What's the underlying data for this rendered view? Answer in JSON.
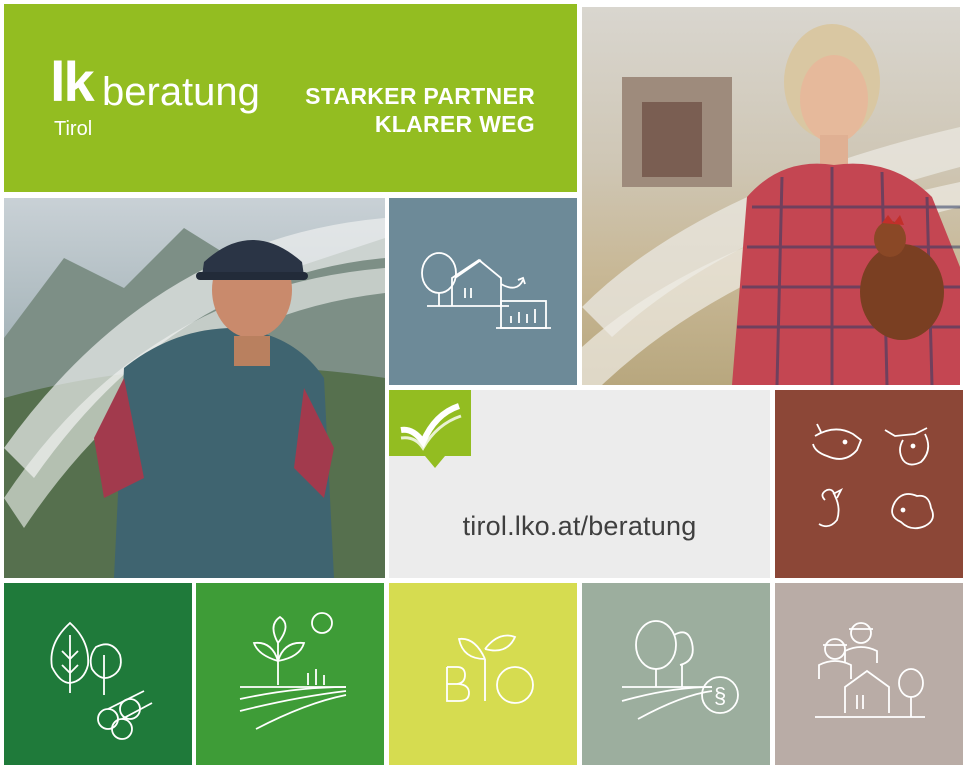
{
  "brand": {
    "mark": "lk",
    "word": "beratung",
    "region": "Tirol",
    "slogan_line1": "STARKER PARTNER",
    "slogan_line2": "KLARER WEG",
    "color": "#93bd21"
  },
  "web": {
    "url": "tirol.lko.at/beratung",
    "badge_icon": "check-speech-bubble-icon",
    "badge_color": "#93bd21"
  },
  "bio": {
    "letters": "B O"
  },
  "tiles": [
    {
      "icon": "farm-chart-icon",
      "color": "#6d8a98"
    },
    {
      "icon": "farm-animals-icon",
      "color": "#8c4737"
    },
    {
      "icon": "forest-timber-icon",
      "color": "#1f7a3a"
    },
    {
      "icon": "crop-field-icon",
      "color": "#3e9c37"
    },
    {
      "icon": "bio-sprout-icon",
      "color": "#d6dc50"
    },
    {
      "icon": "legal-paragraph-icon",
      "color": "#9cae9e"
    },
    {
      "icon": "farm-family-icon",
      "color": "#b9aca6"
    }
  ],
  "photos": [
    {
      "subject": "woman-with-chicken-photo"
    },
    {
      "subject": "farmer-man-photo"
    }
  ]
}
